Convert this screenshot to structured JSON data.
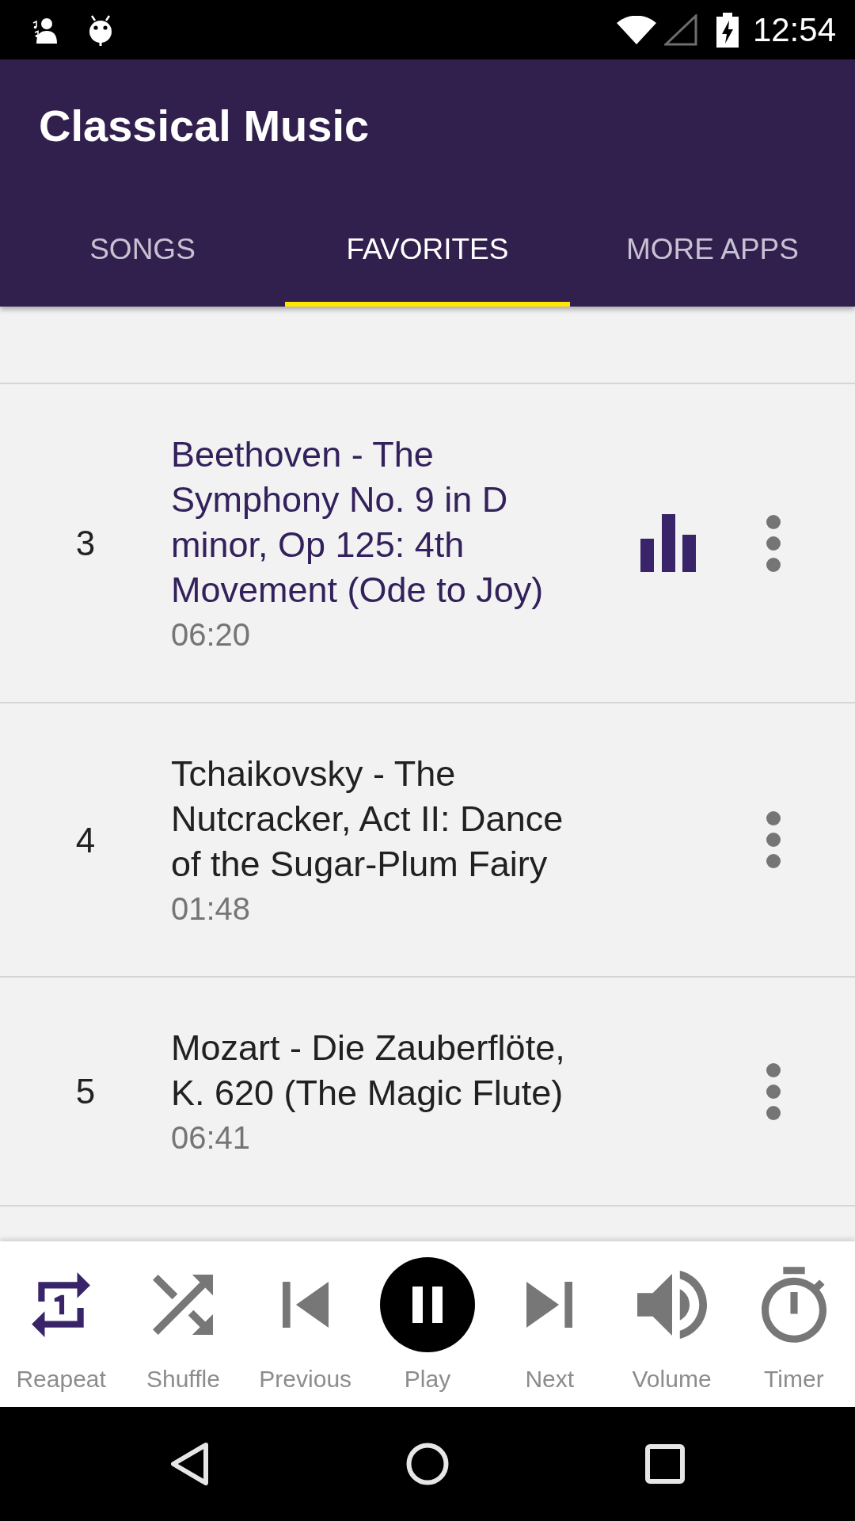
{
  "status_bar": {
    "time": "12:54"
  },
  "app_bar": {
    "title": "Classical Music"
  },
  "tabs": [
    {
      "label": "SONGS",
      "selected": false
    },
    {
      "label": "FAVORITES",
      "selected": true
    },
    {
      "label": "MORE APPS",
      "selected": false
    }
  ],
  "songs": [
    {
      "number": "3",
      "title": "Beethoven - The Symphony No. 9 in D minor, Op 125: 4th Movement (Ode to Joy)",
      "duration": "06:20",
      "playing": true
    },
    {
      "number": "4",
      "title": "Tchaikovsky - The Nutcracker, Act II: Dance of the Sugar-Plum Fairy",
      "duration": "01:48",
      "playing": false
    },
    {
      "number": "5",
      "title": "Mozart - Die Zauberflöte, K. 620 (The Magic Flute)",
      "duration": "06:41",
      "playing": false
    }
  ],
  "player_controls": [
    {
      "kind": "repeat",
      "label": "Reapeat",
      "on": true
    },
    {
      "kind": "shuffle",
      "label": "Shuffle",
      "on": false
    },
    {
      "kind": "previous",
      "label": "Previous"
    },
    {
      "kind": "play",
      "label": "Play",
      "playing": true
    },
    {
      "kind": "next",
      "label": "Next"
    },
    {
      "kind": "volume",
      "label": "Volume"
    },
    {
      "kind": "timer",
      "label": "Timer"
    }
  ]
}
